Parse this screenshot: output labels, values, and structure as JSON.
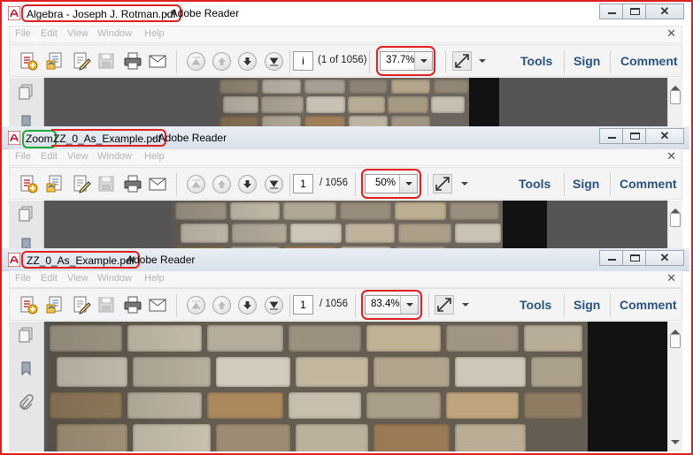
{
  "app_name": "Adobe Reader",
  "menus": [
    "File",
    "Edit",
    "View",
    "Window",
    "Help"
  ],
  "side_links": {
    "tools": "Tools",
    "sign": "Sign",
    "comment": "Comment"
  },
  "annotations": {
    "zoom_label": "Zoom"
  },
  "colors": {
    "annotation_red": "#e02020",
    "annotation_green": "#22a83a",
    "link_blue": "#2a5382"
  },
  "window_buttons": [
    "minimize",
    "maximize",
    "close"
  ],
  "toolbar_icons": [
    "create-icon",
    "open-icon",
    "edit-icon",
    "save-icon",
    "print-icon",
    "email-icon",
    "first-page-icon",
    "prev-page-icon",
    "next-page-icon",
    "last-page-icon",
    "fit-width-icon"
  ],
  "windows": [
    {
      "file_name": "Algebra - Joseph J. Rotman.pdf",
      "title_rest": "- Adobe Reader",
      "page_value": "i",
      "page_total": "(1 of 1056)",
      "zoom": "37.7%"
    },
    {
      "file_name": "ZZ_0_As_Example.pdf",
      "title_rest": "- Adobe Reader",
      "page_value": "1",
      "page_total": "/ 1056",
      "zoom": "50%"
    },
    {
      "file_name": "ZZ_0_As_Example.pdf",
      "title_rest": "Adobe Reader",
      "page_value": "1",
      "page_total": "/ 1056",
      "zoom": "83.4%"
    }
  ]
}
